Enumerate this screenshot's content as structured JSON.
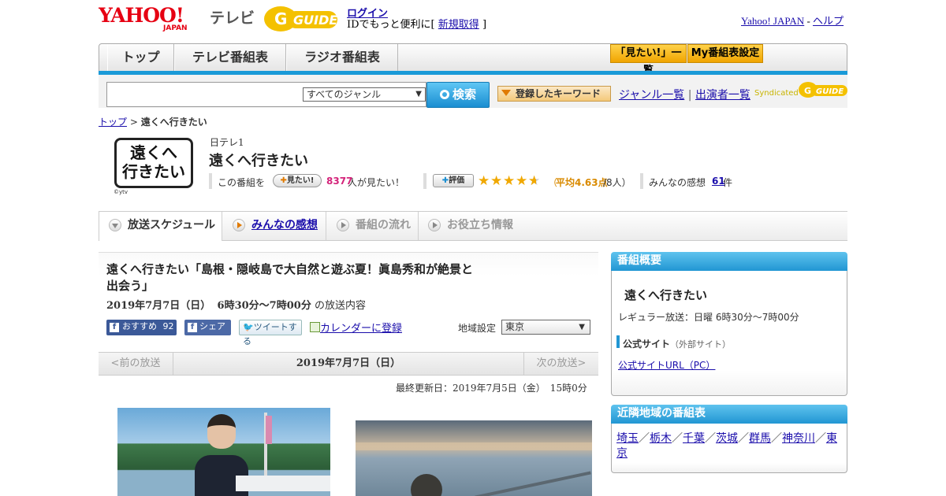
{
  "header": {
    "yahoo_logo": "YAHOO! JAPAN",
    "tv_label": "テレビ",
    "gguide_logo": "G-GUIDE",
    "login": "ログイン",
    "login_sub_prefix": "IDでもっと便利に[",
    "signup": "新規取得",
    "login_sub_suffix": "]",
    "yahoo_japan_link": "Yahoo! JAPAN",
    "help_link": "ヘルプ",
    "links_sep": " - "
  },
  "nav": {
    "tabs": [
      "トップ",
      "テレビ番組表",
      "ラジオ番組表"
    ],
    "mitai_list": "「見たい!」一覧",
    "my_schedule": "My番組表設定"
  },
  "search": {
    "input_value": "",
    "genre_selected": "すべてのジャンル",
    "search_button": "検索",
    "keyword_button": "登録したキーワード",
    "genre_list": "ジャンル一覧",
    "performer_list": "出演者一覧",
    "syndicated": "Syndicated"
  },
  "breadcrumb": {
    "top": "トップ",
    "sep": ">",
    "current": "遠くへ行きたい"
  },
  "program": {
    "logo_line1": "遠くへ",
    "logo_line2": "行きたい",
    "logo_credit": "©ytv",
    "channel": "日テレ1",
    "title": "遠くへ行きたい",
    "this_program": "この番組を",
    "mitai_button": "見たい!",
    "mitai_count": "8377",
    "mitai_suffix": "人が見たい！",
    "rate_button": "評価",
    "rating": 4.63,
    "rating_prefix": "（",
    "rating_avg_label": "平均4.63点",
    "rating_count": "/8人）",
    "comments_label": "みんなの感想",
    "comments_count": "61",
    "comments_suffix": "件"
  },
  "tabs": [
    {
      "label": "放送スケジュール",
      "state": "active"
    },
    {
      "label": "みんなの感想",
      "state": "link"
    },
    {
      "label": "番組の流れ",
      "state": "disabled"
    },
    {
      "label": "お役立ち情報",
      "state": "disabled"
    }
  ],
  "episode": {
    "title": "遠くへ行きたい「島根・隠岐島で大自然と遊ぶ夏！眞島秀和が絶景と出会う」",
    "date": "2019年7月7日（日）",
    "time": "6時30分～7時00分",
    "date_suffix": "の放送内容",
    "recommend": "おすすめ",
    "recommend_count": "92",
    "share": "シェア",
    "tweet": "ツイートする",
    "calendar": "カレンダーに登録",
    "region_label": "地域設定",
    "region_value": "東京"
  },
  "pager": {
    "prev": "<前の放送",
    "current": "2019年7月7日（日）",
    "next": "次の放送>"
  },
  "updated": "最終更新日：2019年7月5日（金）　15時0分",
  "sidebar": {
    "overview_head": "番組概要",
    "overview_title": "遠くへ行きたい",
    "regular": "レギュラー放送：日曜 6時30分～7時00分",
    "official_label": "公式サイト",
    "external": "（外部サイト）",
    "official_link": "公式サイトURL（PC）",
    "nearby_head": "近隣地域の番組表",
    "nearby": [
      "埼玉",
      "栃木",
      "千葉",
      "茨城",
      "群馬",
      "神奈川",
      "東京"
    ]
  },
  "colors": {
    "accent_blue": "#1a9ad8",
    "star": "#f0a800",
    "rating_text": "#d98a00",
    "count_pink": "#d4237a"
  }
}
